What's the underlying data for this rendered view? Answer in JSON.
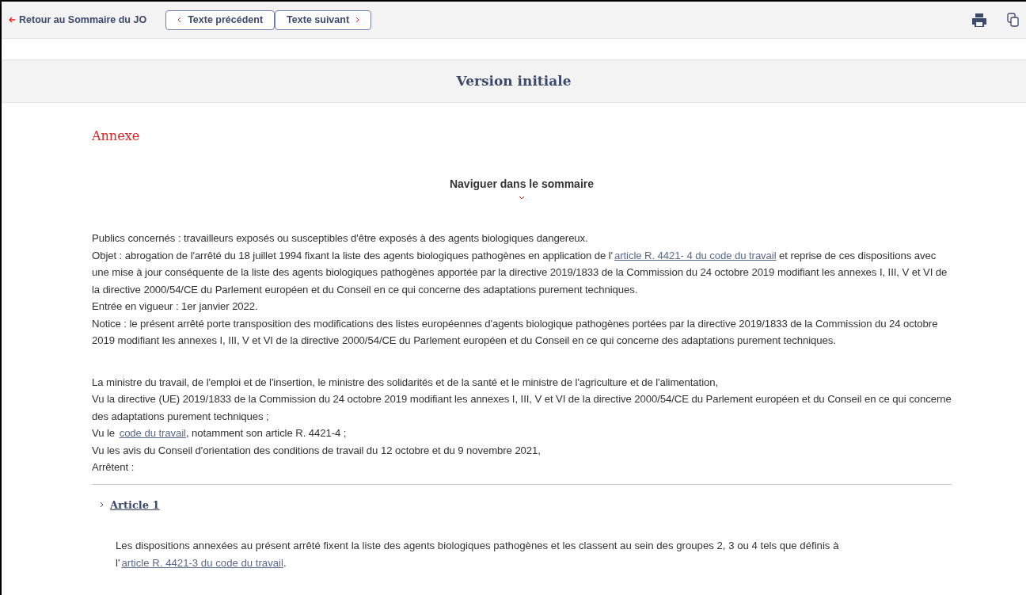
{
  "toolbar": {
    "back_link": "Retour au Sommaire du JO",
    "buttons": [
      {
        "label": "Texte précédent",
        "kind": "prev"
      },
      {
        "label": "Texte suivant",
        "kind": "next"
      }
    ]
  },
  "version_heading": "Version initiale",
  "annex_title": "Annexe",
  "summary_toggle": {
    "label": "Naviguer dans le sommaire",
    "expanded": false
  },
  "notice_lines": [
    {
      "parts": [
        {
          "kind": "text",
          "text": "Publics concernés : travailleurs exposés ou susceptibles d'être exposés à des agents biologiques dangereux."
        }
      ]
    },
    {
      "parts": [
        {
          "kind": "text",
          "text": "Objet : abrogation de l'arrêté du 18 juillet 1994 fixant la liste des agents biologiques pathogènes en application de l'"
        },
        {
          "kind": "link",
          "text": "article R. 4421- 4 du code du travail"
        },
        {
          "kind": "text",
          "text": " et reprise de ces dispositions avec une mise à jour conséquente de la liste des agents biologiques pathogènes apportée par la directive 2019/1833 de la Commission du 24 octobre 2019 modifiant les annexes I, III, V et VI de la directive 2000/54/CE du Parlement européen et du Conseil en ce qui concerne des adaptations purement techniques."
        }
      ]
    },
    {
      "parts": [
        {
          "kind": "text",
          "text": "Entrée en vigueur : 1er janvier 2022."
        }
      ]
    },
    {
      "parts": [
        {
          "kind": "text",
          "text": "Notice : le présent arrêté porte transposition des modifications des listes européennes d'agents biologique pathogènes portées par la directive 2019/1833 de la Commission du 24 octobre 2019 modifiant les annexes I, III, V et VI de la directive 2000/54/CE du Parlement européen et du Conseil en ce qui concerne des adaptations purement techniques."
        }
      ]
    }
  ],
  "preamble_lines": [
    {
      "parts": [
        {
          "kind": "text",
          "text": "La ministre du travail, de l'emploi et de l'insertion, le ministre des solidarités et de la santé et le ministre de l'agriculture et de l'alimentation,"
        }
      ]
    },
    {
      "parts": [
        {
          "kind": "text",
          "text": "Vu la directive (UE) 2019/1833 de la Commission du 24 octobre 2019 modifiant les annexes I, III, V et VI de la directive 2000/54/CE du Parlement européen et du Conseil en ce qui concerne des adaptations purement techniques ;"
        }
      ]
    },
    {
      "parts": [
        {
          "kind": "text",
          "text": "Vu le "
        },
        {
          "kind": "link",
          "text": "code du travail"
        },
        {
          "kind": "text",
          "text": ", notamment son article R. 4421-4 ;"
        }
      ]
    },
    {
      "parts": [
        {
          "kind": "text",
          "text": "Vu les avis du Conseil d'orientation des conditions de travail du 12 octobre et du 9 novembre 2021,"
        }
      ]
    },
    {
      "parts": [
        {
          "kind": "text",
          "text": "Arrêtent :"
        }
      ]
    }
  ],
  "articles": [
    {
      "title": "Article 1",
      "expanded": false,
      "body": [
        {
          "kind": "text",
          "text": "Les dispositions annexées au présent arrêté fixent la liste des agents biologiques pathogènes et les classent au sein des groupes 2, 3 ou 4 tels que définis à l'"
        },
        {
          "kind": "link",
          "text": "article R. 4421-3 du code du travail"
        },
        {
          "kind": "text",
          "text": "."
        }
      ]
    }
  ]
}
